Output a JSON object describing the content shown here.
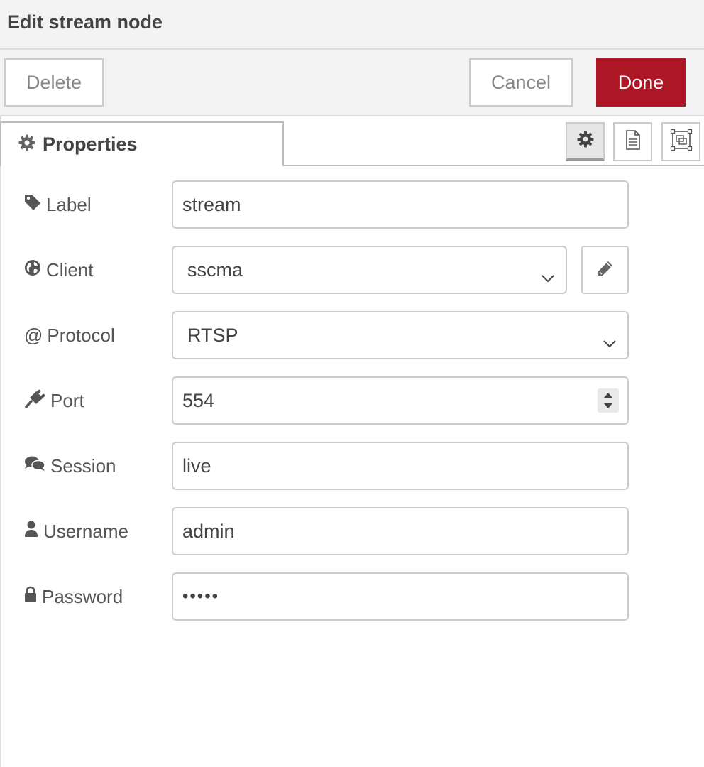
{
  "window": {
    "title": "Edit stream node"
  },
  "toolbar": {
    "delete_label": "Delete",
    "cancel_label": "Cancel",
    "done_label": "Done"
  },
  "colors": {
    "done_button": "#ad1625",
    "header_bg": "#f3f3f3",
    "border": "#cccccc"
  },
  "tabs": {
    "properties_label": "Properties"
  },
  "tray_icons": [
    "gear-icon",
    "description-icon",
    "layout-icon"
  ],
  "form": {
    "label": {
      "caption": "Label",
      "icon": "tag-icon",
      "value": "stream"
    },
    "client": {
      "caption": "Client",
      "icon": "globe-icon",
      "value": "sscma"
    },
    "protocol": {
      "caption": "Protocol",
      "icon": "at-icon",
      "prefix": "@",
      "value": "RTSP"
    },
    "port": {
      "caption": "Port",
      "icon": "plug-icon",
      "value": "554"
    },
    "session": {
      "caption": "Session",
      "icon": "comments-icon",
      "value": "live"
    },
    "username": {
      "caption": "Username",
      "icon": "user-icon",
      "value": "admin"
    },
    "password": {
      "caption": "Password",
      "icon": "lock-icon",
      "value": "•••••"
    }
  }
}
